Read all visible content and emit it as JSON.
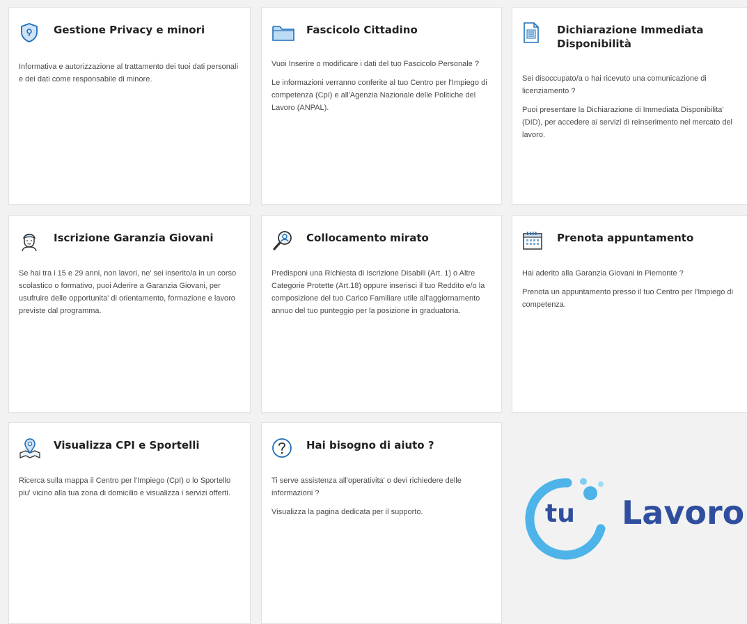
{
  "cards": [
    {
      "title": "Gestione Privacy e minori",
      "icon": "shield-icon",
      "paragraphs": [
        "Informativa e autorizzazione al trattamento dei tuoi dati personali e dei dati come responsabile di minore."
      ]
    },
    {
      "title": "Fascicolo Cittadino",
      "icon": "folder-icon",
      "paragraphs": [
        "Vuoi Inserire o modificare i dati del tuo Fascicolo Personale ?",
        "Le informazioni verranno conferite al tuo Centro per l'Impiego di competenza (CpI) e all'Agenzia Nazionale delle Politiche del Lavoro (ANPAL)."
      ]
    },
    {
      "title": "Dichiarazione Immediata Disponibilità",
      "icon": "document-icon",
      "paragraphs": [
        "Sei disoccupato/a o hai ricevuto una comunicazione di licenziamento ?",
        "Puoi presentare la Dichiarazione di Immediata Disponibilita' (DID), per accedere ai servizi di reinserimento nel mercato del lavoro."
      ]
    },
    {
      "title": "Iscrizione Garanzia Giovani",
      "icon": "young-person-icon",
      "paragraphs": [
        "Se hai tra i 15 e 29 anni, non lavori, ne' sei inserito/a in un corso scolastico o formativo, puoi Aderire a Garanzia Giovani, per usufruire delle opportunita' di orientamento, formazione e lavoro previste dal programma."
      ]
    },
    {
      "title": "Collocamento mirato",
      "icon": "magnifier-person-icon",
      "paragraphs": [
        "Predisponi una Richiesta di Iscrizione Disabili (Art. 1) o Altre Categorie Protette (Art.18) oppure inserisci il tuo Reddito e/o la composizione del tuo Carico Familiare utile all'aggiornamento annuo del tuo punteggio per la posizione in graduatoria."
      ]
    },
    {
      "title": "Prenota appuntamento",
      "icon": "calendar-icon",
      "paragraphs": [
        "Hai aderito alla Garanzia Giovani in Piemonte ?",
        "Prenota un appuntamento presso il tuo Centro per l'Impiego di competenza."
      ]
    },
    {
      "title": "Visualizza CPI e Sportelli",
      "icon": "map-pin-icon",
      "paragraphs": [
        "Ricerca sulla mappa il Centro per l'Impiego (CpI) o lo Sportello piu' vicino alla tua zona di domicilio e visualizza i servizi offerti."
      ]
    },
    {
      "title": "Hai bisogno di aiuto ?",
      "icon": "help-icon",
      "paragraphs": [
        "Ti serve assistenza all'operativita' o devi richiedere delle informazioni ?",
        "Visualizza la pagina dedicata per il supporto."
      ]
    }
  ],
  "logo": {
    "prefix": "tu",
    "word": "Lavoro"
  },
  "colors": {
    "accent": "#1e8ad6",
    "logo_blue": "#2f4f9e",
    "logo_ring": "#4db3e8"
  }
}
